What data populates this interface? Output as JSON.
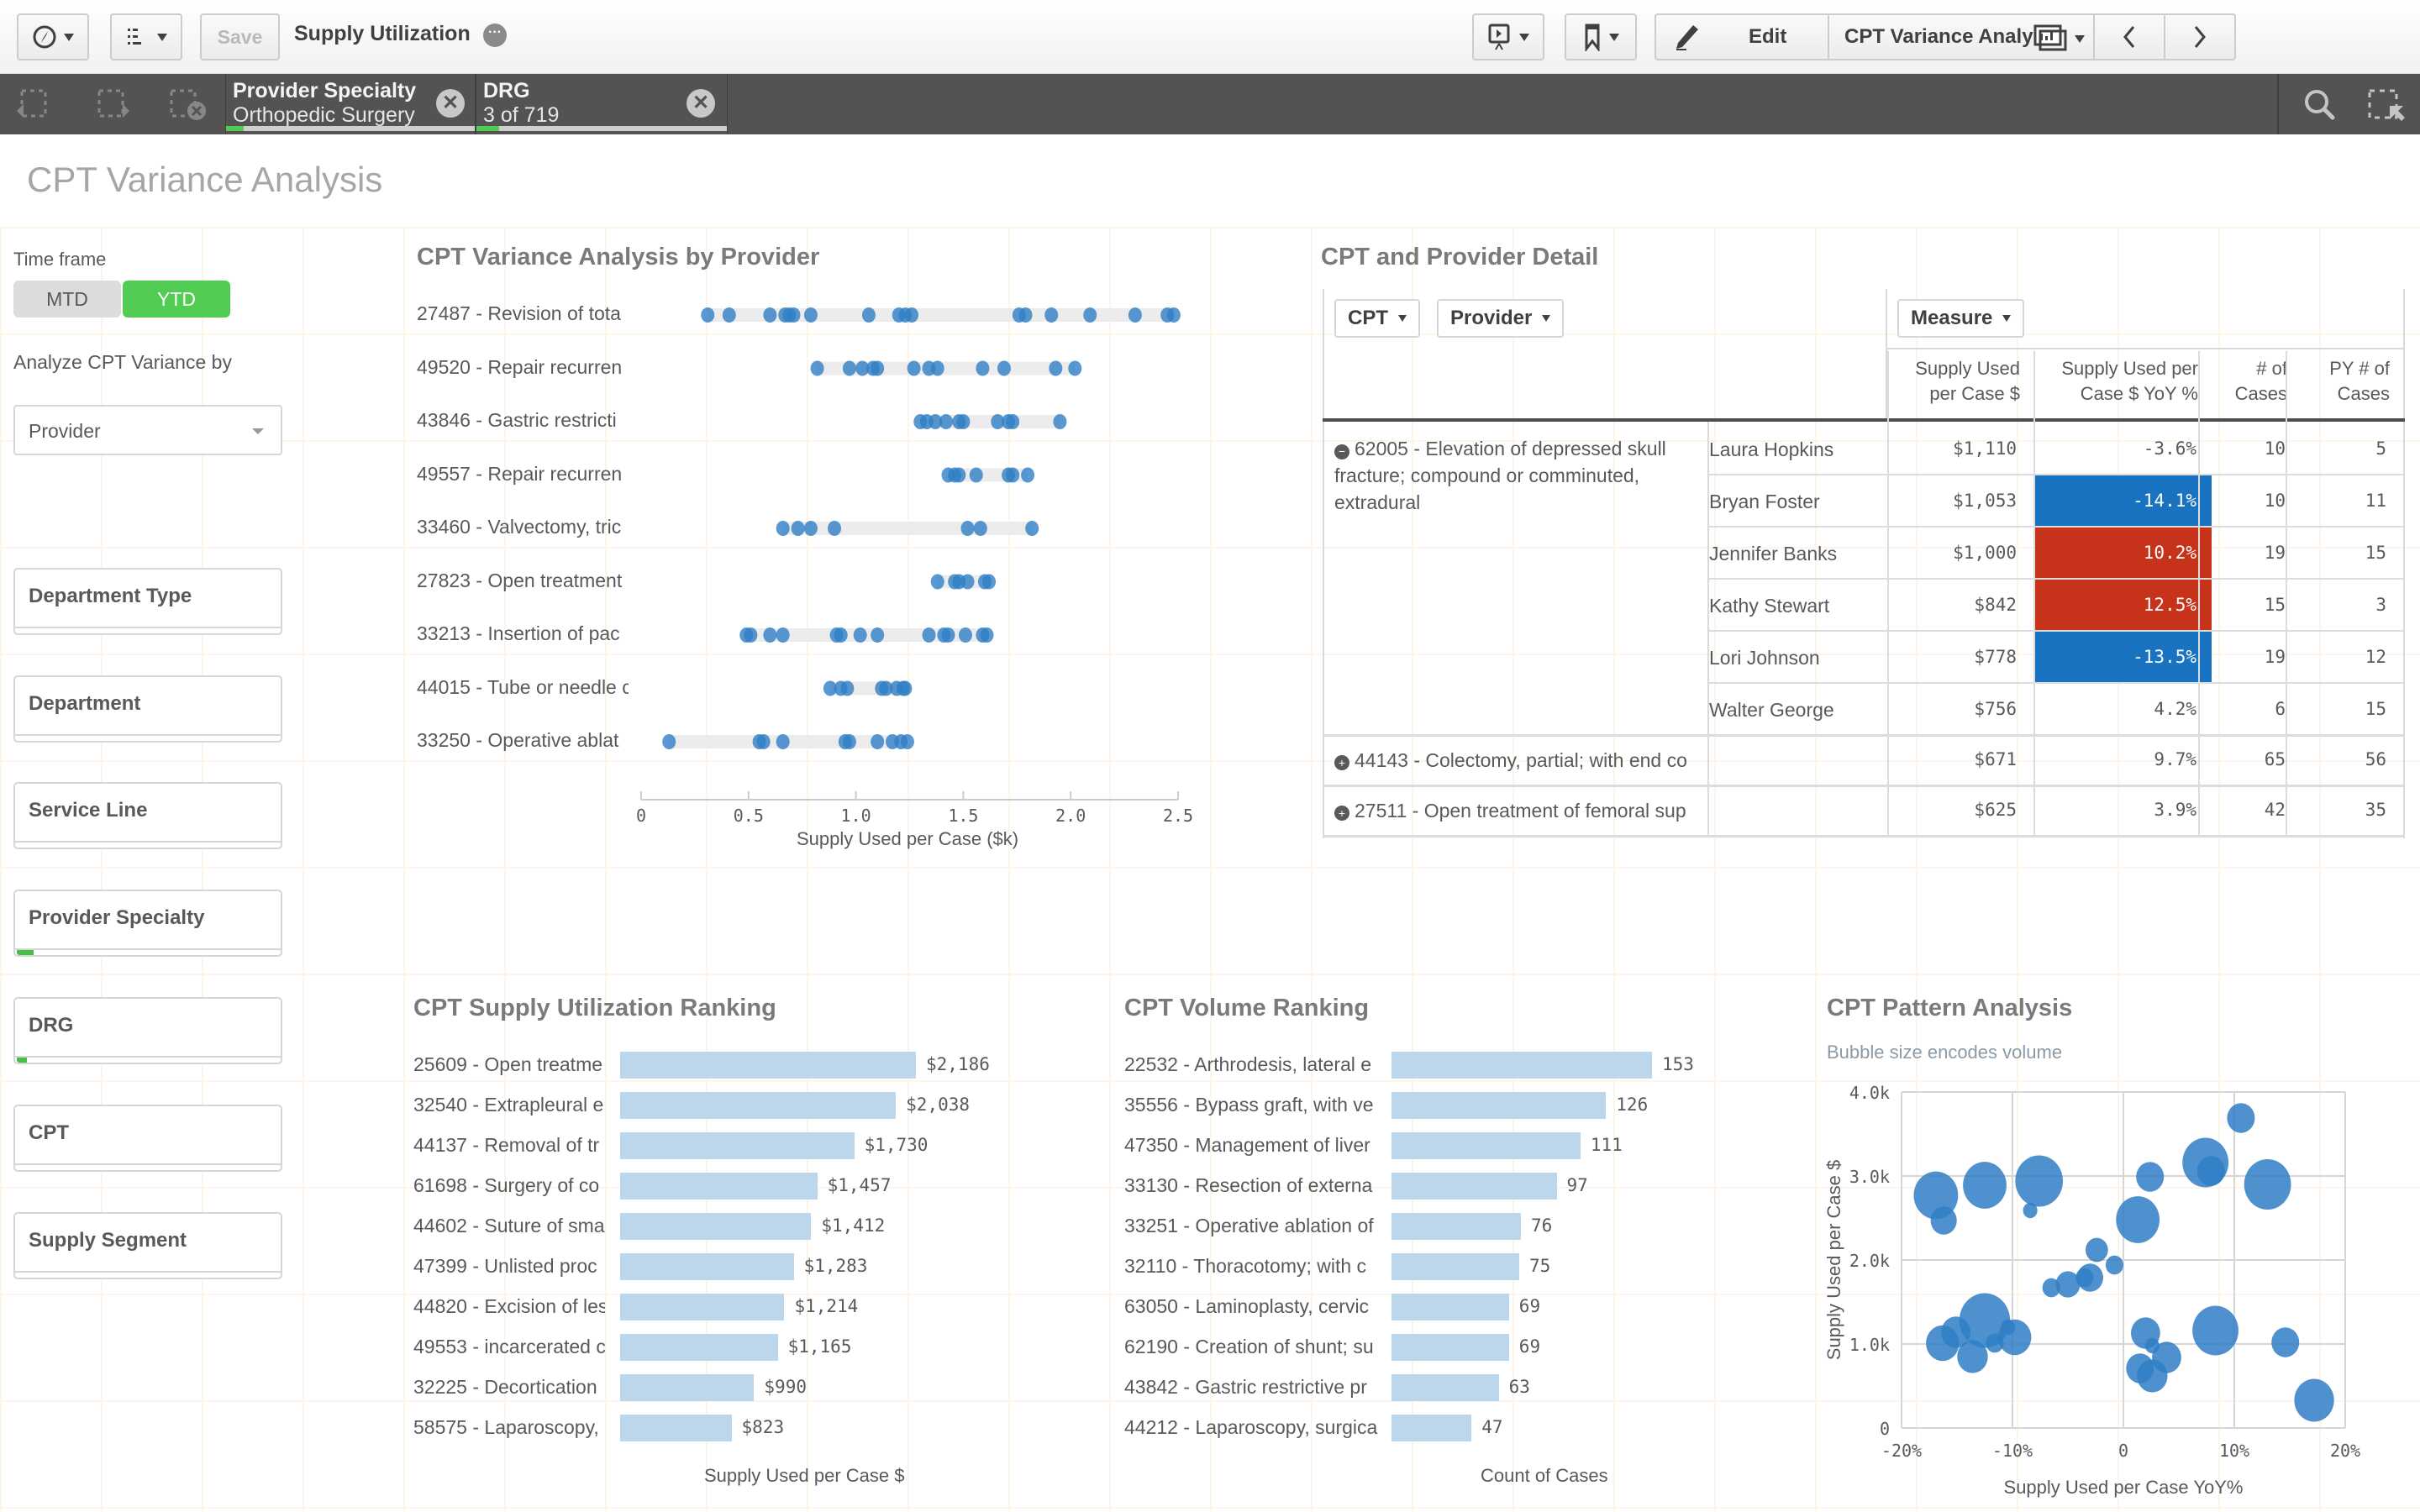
{
  "toolbar": {
    "save_label": "Save",
    "app_title": "Supply Utilization",
    "edit_label": "Edit",
    "sheet_name": "CPT Variance Analysis",
    "icons": [
      "compass-icon",
      "list-icon",
      "more-icon",
      "presentation-icon",
      "bookmark-icon",
      "pencil-icon",
      "sheets-icon",
      "chevron-left-icon",
      "chevron-right-icon"
    ]
  },
  "selections": {
    "chips": [
      {
        "field": "Provider Specialty",
        "value": "Orthopedic Surgery",
        "fraction_selected": 0.07
      },
      {
        "field": "DRG",
        "value": "3 of 719",
        "fraction_selected": 0.08
      }
    ],
    "icons": [
      "step-back-icon",
      "step-forward-icon",
      "clear-all-icon",
      "search-icon",
      "selection-tool-icon"
    ]
  },
  "sheet": {
    "title": "CPT Variance Analysis"
  },
  "filters": {
    "time_frame_label": "Time frame",
    "time_frame_options": [
      {
        "label": "MTD",
        "selected": false
      },
      {
        "label": "YTD",
        "selected": true
      }
    ],
    "analyze_label": "Analyze CPT Variance by",
    "analyze_value": "Provider",
    "listboxes": [
      {
        "label": "Department Type",
        "selected_fraction": 0
      },
      {
        "label": "Department",
        "selected_fraction": 0
      },
      {
        "label": "Service Line",
        "selected_fraction": 0
      },
      {
        "label": "Provider Specialty",
        "selected_fraction": 0.07
      },
      {
        "label": "DRG",
        "selected_fraction": 0.04
      },
      {
        "label": "CPT",
        "selected_fraction": 0
      },
      {
        "label": "Supply Segment",
        "selected_fraction": 0
      }
    ]
  },
  "detail_table": {
    "title": "CPT and Provider Detail",
    "dim_buttons": [
      "CPT",
      "Provider"
    ],
    "measure_button": "Measure",
    "columns": [
      "Supply Used per Case $",
      "Supply Used per Case $ YoY %",
      "# of Cases",
      "PY # of Cases"
    ],
    "groups": [
      {
        "cpt": "62005 - Elevation of depressed skull fracture; compound or comminuted, extradural",
        "expanded": true,
        "rows": [
          {
            "provider": "Laura Hopkins",
            "supply": "$1,110",
            "yoy": "-3.6%",
            "cases": "10",
            "py_cases": "5",
            "highlight": "none"
          },
          {
            "provider": "Bryan Foster",
            "supply": "$1,053",
            "yoy": "-14.1%",
            "cases": "10",
            "py_cases": "11",
            "highlight": "blue"
          },
          {
            "provider": "Jennifer Banks",
            "supply": "$1,000",
            "yoy": "10.2%",
            "cases": "19",
            "py_cases": "15",
            "highlight": "red"
          },
          {
            "provider": "Kathy Stewart",
            "supply": "$842",
            "yoy": "12.5%",
            "cases": "15",
            "py_cases": "3",
            "highlight": "red"
          },
          {
            "provider": "Lori Johnson",
            "supply": "$778",
            "yoy": "-13.5%",
            "cases": "19",
            "py_cases": "12",
            "highlight": "blue"
          },
          {
            "provider": "Walter George",
            "supply": "$756",
            "yoy": "4.2%",
            "cases": "6",
            "py_cases": "15",
            "highlight": "none"
          }
        ]
      },
      {
        "cpt": "44143 - Colectomy, partial; with end co",
        "expanded": false,
        "supply": "$671",
        "yoy": "9.7%",
        "cases": "65",
        "py_cases": "56"
      },
      {
        "cpt": "27511 - Open treatment of femoral sup",
        "expanded": false,
        "supply": "$625",
        "yoy": "3.9%",
        "cases": "42",
        "py_cases": "35"
      }
    ],
    "colors": {
      "blue": "#1a73c0",
      "red": "#c7321b"
    }
  },
  "chart_data": [
    {
      "type": "scatter",
      "title": "CPT Variance Analysis by Provider",
      "xlabel": "Supply Used per Case ($k)",
      "ylabel": "",
      "xlim": [
        0,
        2.5
      ],
      "xticks": [
        "0",
        "0.5",
        "1.0",
        "1.5",
        "2.0",
        "2.5"
      ],
      "color": "#2f7ec5",
      "categories": [
        "27487 - Revision of tota",
        "49520 - Repair recurren",
        "43846 - Gastric restricti",
        "49557 - Repair recurren",
        "33460 - Valvectomy, tric",
        "27823 - Open treatment",
        "33213 - Insertion of pac",
        "44015 - Tube or needle c",
        "33250 - Operative ablat"
      ],
      "series": [
        {
          "name": "27487 - Revision of tota",
          "values": [
            0.31,
            0.41,
            0.6,
            0.67,
            0.69,
            0.71,
            0.79,
            1.06,
            1.2,
            1.23,
            1.26,
            1.76,
            1.79,
            1.91,
            2.09,
            2.3,
            2.45,
            2.48
          ]
        },
        {
          "name": "49520 - Repair recurren",
          "values": [
            0.82,
            0.97,
            1.03,
            1.08,
            1.1,
            1.27,
            1.34,
            1.38,
            1.59,
            1.69,
            1.93,
            2.02
          ]
        },
        {
          "name": "43846 - Gastric restricti",
          "values": [
            1.3,
            1.33,
            1.37,
            1.42,
            1.48,
            1.5,
            1.66,
            1.71,
            1.73,
            1.95
          ]
        },
        {
          "name": "49557 - Repair recurren",
          "values": [
            1.43,
            1.46,
            1.48,
            1.56,
            1.71,
            1.73,
            1.8
          ]
        },
        {
          "name": "33460 - Valvectomy, tric",
          "values": [
            0.66,
            0.73,
            0.79,
            0.9,
            1.52,
            1.58,
            1.82
          ]
        },
        {
          "name": "27823 - Open treatment",
          "values": [
            1.38,
            1.46,
            1.48,
            1.52,
            1.6,
            1.62
          ]
        },
        {
          "name": "33213 - Insertion of pac",
          "values": [
            0.49,
            0.51,
            0.6,
            0.66,
            0.91,
            0.93,
            1.02,
            1.1,
            1.34,
            1.41,
            1.43,
            1.51,
            1.59,
            1.61
          ]
        },
        {
          "name": "44015 - Tube or needle c",
          "values": [
            0.88,
            0.93,
            0.96,
            1.12,
            1.14,
            1.19,
            1.22,
            1.23
          ]
        },
        {
          "name": "33250 - Operative ablat",
          "values": [
            0.13,
            0.55,
            0.57,
            0.66,
            0.95,
            0.97,
            1.1,
            1.17,
            1.21,
            1.24
          ]
        }
      ]
    },
    {
      "type": "bar",
      "title": "CPT Supply Utilization Ranking",
      "xlabel": "Supply Used per Case $",
      "ylabel": "",
      "categories": [
        "25609 - Open treatme",
        "32540 - Extrapleural e",
        "44137 - Removal of tr",
        "61698 - Surgery of co",
        "44602 - Suture of sma",
        "47399 - Unlisted proc",
        "44820 - Excision of les",
        "49553 - incarcerated c",
        "32225 - Decortication",
        "58575 - Laparoscopy,"
      ],
      "values": [
        2186,
        2038,
        1730,
        1457,
        1412,
        1283,
        1214,
        1165,
        990,
        823
      ],
      "labels": [
        "$2,186",
        "$2,038",
        "$1,730",
        "$1,457",
        "$1,412",
        "$1,283",
        "$1,214",
        "$1,165",
        "$990",
        "$823"
      ],
      "color": "#bcd6eb"
    },
    {
      "type": "bar",
      "title": "CPT Volume Ranking",
      "xlabel": "Count of Cases",
      "ylabel": "",
      "categories": [
        "22532 - Arthrodesis, lateral e",
        "35556 - Bypass graft, with ve",
        "47350 - Management of liver",
        "33130 - Resection of externa",
        "33251 - Operative ablation of",
        "32110 - Thoracotomy; with c",
        "63050 - Laminoplasty, cervic",
        "62190 - Creation of shunt; su",
        "43842 - Gastric restrictive pr",
        "44212 - Laparoscopy, surgica"
      ],
      "values": [
        153,
        126,
        111,
        97,
        76,
        75,
        69,
        69,
        63,
        47
      ],
      "labels": [
        "153",
        "126",
        "111",
        "97",
        "76",
        "75",
        "69",
        "69",
        "63",
        "47"
      ],
      "color": "#bcd6eb"
    },
    {
      "type": "scatter",
      "title": "CPT Pattern Analysis",
      "subtitle": "Bubble size encodes volume",
      "xlabel": "Supply Used per Case YoY%",
      "ylabel": "Supply Used per Case $",
      "xlim": [
        -20,
        20
      ],
      "ylim": [
        0,
        4000
      ],
      "xticks": [
        "-20%",
        "-10%",
        "0",
        "10%",
        "20%"
      ],
      "yticks": [
        "0",
        "1.0k",
        "2.0k",
        "3.0k",
        "4.0k"
      ],
      "grid": true,
      "color": "#2f7ec5",
      "points": [
        {
          "x": -16.9,
          "y": 2770,
          "size": 22
        },
        {
          "x": -12.5,
          "y": 2890,
          "size": 21
        },
        {
          "x": -7.6,
          "y": 2940,
          "size": 26
        },
        {
          "x": -16.2,
          "y": 2470,
          "size": 6
        },
        {
          "x": -8.4,
          "y": 2590,
          "size": 1
        },
        {
          "x": 1.3,
          "y": 2480,
          "size": 21
        },
        {
          "x": 2.4,
          "y": 2990,
          "size": 7
        },
        {
          "x": 7.4,
          "y": 3160,
          "size": 24
        },
        {
          "x": 7.9,
          "y": 3060,
          "size": 7
        },
        {
          "x": 10.6,
          "y": 3690,
          "size": 7
        },
        {
          "x": 13.0,
          "y": 2900,
          "size": 25
        },
        {
          "x": -2.4,
          "y": 2120,
          "size": 4
        },
        {
          "x": -0.8,
          "y": 1940,
          "size": 2
        },
        {
          "x": -6.5,
          "y": 1670,
          "size": 2
        },
        {
          "x": -3.5,
          "y": 1790,
          "size": 2
        },
        {
          "x": -5.0,
          "y": 1710,
          "size": 5
        },
        {
          "x": -3.0,
          "y": 1790,
          "size": 6
        },
        {
          "x": -16.3,
          "y": 1010,
          "size": 11
        },
        {
          "x": -15.1,
          "y": 1140,
          "size": 8
        },
        {
          "x": -12.5,
          "y": 1280,
          "size": 30
        },
        {
          "x": -13.6,
          "y": 850,
          "size": 9
        },
        {
          "x": -11.6,
          "y": 1010,
          "size": 2
        },
        {
          "x": -10.4,
          "y": 1200,
          "size": 1
        },
        {
          "x": -9.8,
          "y": 1080,
          "size": 11
        },
        {
          "x": 2.0,
          "y": 1130,
          "size": 8
        },
        {
          "x": 2.6,
          "y": 980,
          "size": 1
        },
        {
          "x": 3.9,
          "y": 840,
          "size": 8
        },
        {
          "x": 1.5,
          "y": 710,
          "size": 7
        },
        {
          "x": 2.6,
          "y": 620,
          "size": 9
        },
        {
          "x": 8.3,
          "y": 1160,
          "size": 24
        },
        {
          "x": 14.6,
          "y": 1020,
          "size": 7
        },
        {
          "x": 17.2,
          "y": 330,
          "size": 17
        }
      ]
    }
  ]
}
